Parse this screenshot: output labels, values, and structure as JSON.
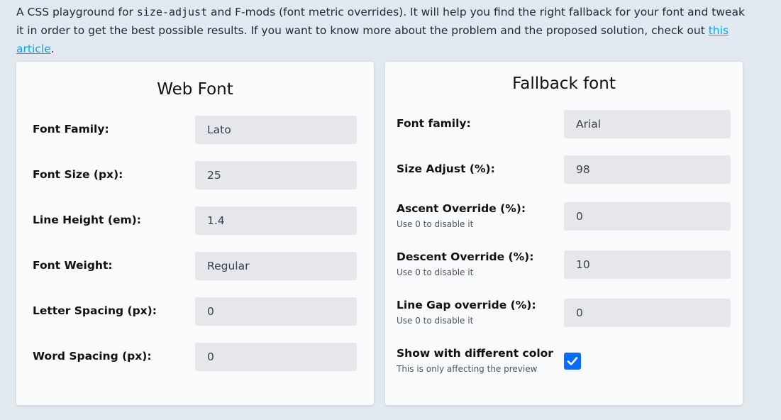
{
  "intro": {
    "text_before": "A CSS playground for ",
    "code": "size-adjust",
    "text_middle": " and F-mods (font metric overrides). It will help you find the right fallback for your font and tweak it in order to get the best possible results. If you want to know more about the problem and the proposed solution, check out ",
    "link": "this article",
    "text_after": "."
  },
  "web_font": {
    "title": "Web Font",
    "rows": [
      {
        "label": "Font Family:",
        "value": "Lato"
      },
      {
        "label": "Font Size (px):",
        "value": "25"
      },
      {
        "label": "Line Height (em):",
        "value": "1.4"
      },
      {
        "label": "Font Weight:",
        "value": "Regular"
      },
      {
        "label": "Letter Spacing (px):",
        "value": "0"
      },
      {
        "label": "Word Spacing (px):",
        "value": "0"
      }
    ]
  },
  "fallback_font": {
    "title": "Fallback font",
    "rows": [
      {
        "label": "Font family:",
        "value": "Arial"
      },
      {
        "label": "Size Adjust (%):",
        "value": "98"
      },
      {
        "label": "Ascent Override (%):",
        "hint": "Use 0 to disable it",
        "value": "0"
      },
      {
        "label": "Descent Override (%):",
        "hint": "Use 0 to disable it",
        "value": "10"
      },
      {
        "label": "Line Gap override (%):",
        "hint": "Use 0 to disable it",
        "value": "0"
      }
    ],
    "color_toggle": {
      "label": "Show with different color",
      "hint": "This is only affecting the preview",
      "checked": true
    }
  },
  "colors": {
    "page_bg": "#e2e8f0",
    "card_bg": "#f8fafc",
    "field_bg": "#e5e7eb",
    "link": "#0ea5e9",
    "checkbox": "#0a6cff"
  }
}
